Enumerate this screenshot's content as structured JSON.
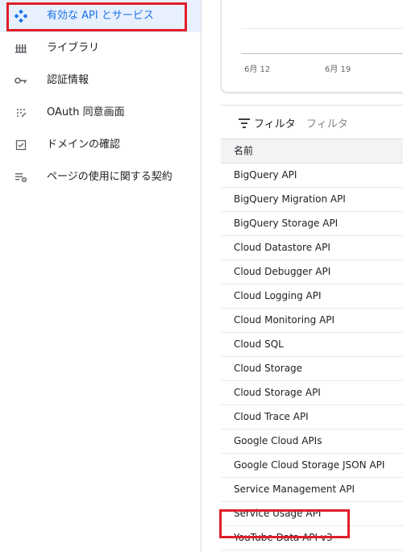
{
  "sidebar": {
    "items": [
      {
        "label": "有効な API とサービス",
        "icon": "api-diamond-icon",
        "active": true
      },
      {
        "label": "ライブラリ",
        "icon": "library-icon"
      },
      {
        "label": "認証情報",
        "icon": "key-icon"
      },
      {
        "label": "OAuth 同意画面",
        "icon": "oauth-consent-icon"
      },
      {
        "label": "ドメインの確認",
        "icon": "checkbox-icon"
      },
      {
        "label": "ページの使用に関する契約",
        "icon": "settings-list-icon"
      }
    ]
  },
  "chart": {
    "x_ticks": [
      "6月 12",
      "6月 19"
    ]
  },
  "filter": {
    "label": "フィルタ",
    "placeholder": "フィルタ"
  },
  "table": {
    "column_name": "名前",
    "rows": [
      "BigQuery API",
      "BigQuery Migration API",
      "BigQuery Storage API",
      "Cloud Datastore API",
      "Cloud Debugger API",
      "Cloud Logging API",
      "Cloud Monitoring API",
      "Cloud SQL",
      "Cloud Storage",
      "Cloud Storage API",
      "Cloud Trace API",
      "Google Cloud APIs",
      "Google Cloud Storage JSON API",
      "Service Management API",
      "Service Usage API",
      "YouTube Data API v3"
    ]
  },
  "colors": {
    "accent": "#1a73e8",
    "highlight": "#e01e28",
    "active_bg": "#e8f0fe"
  }
}
